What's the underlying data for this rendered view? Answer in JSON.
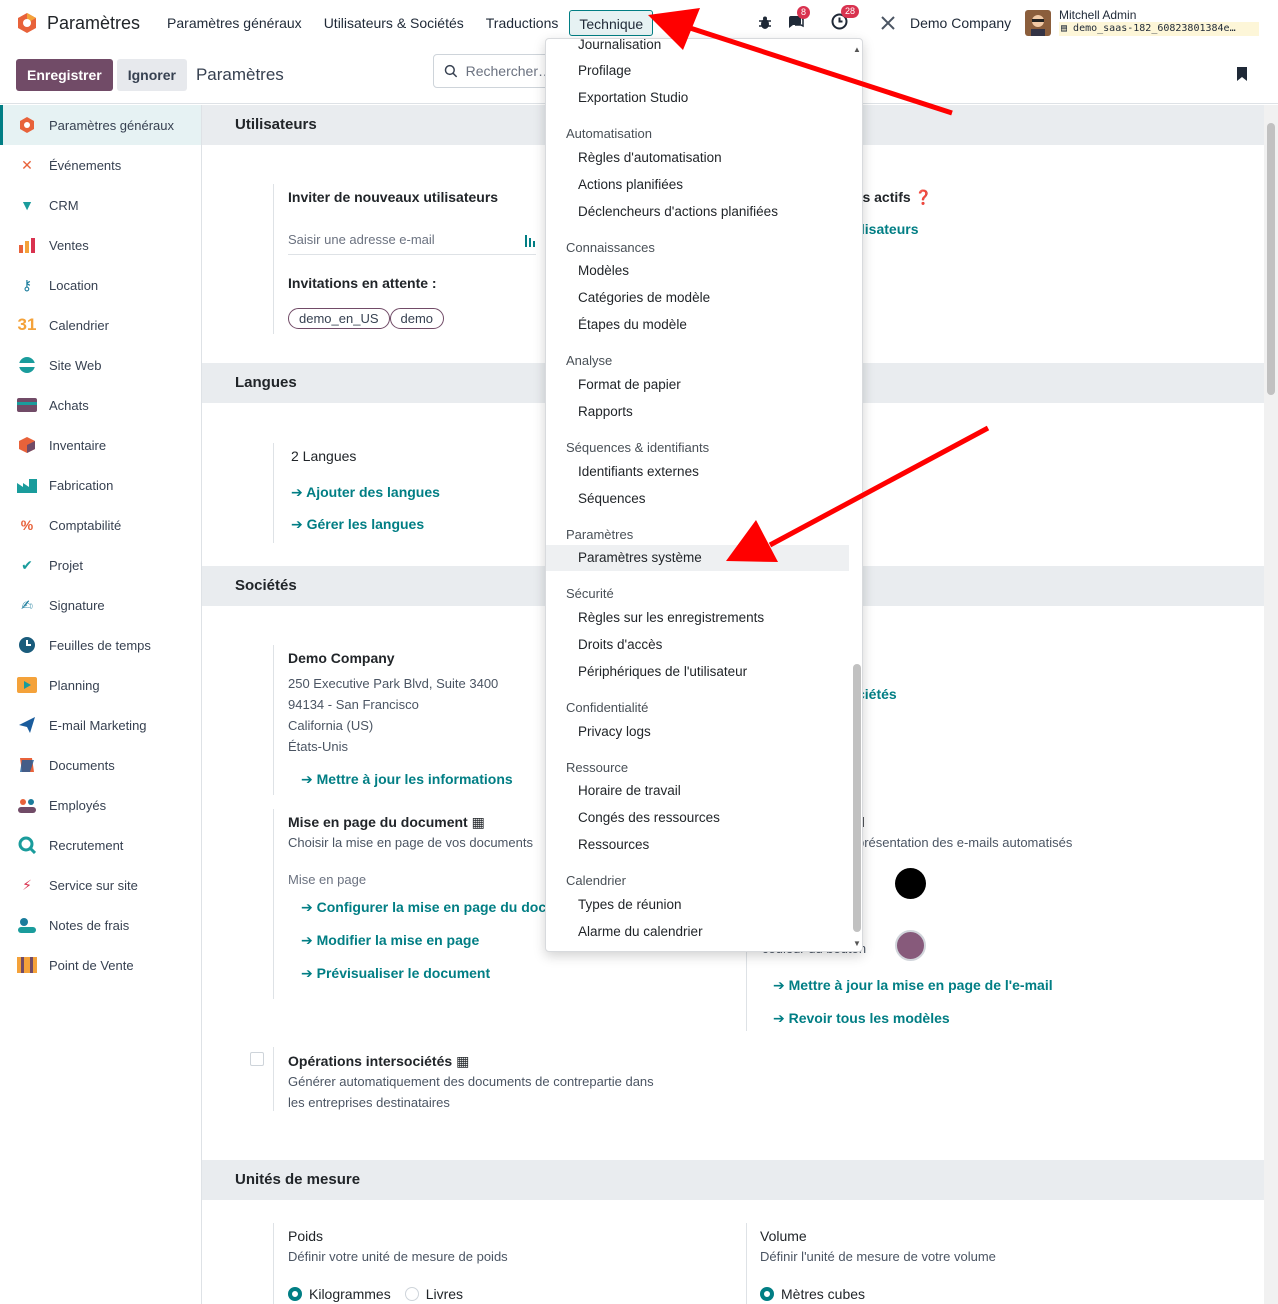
{
  "topbar": {
    "app_title": "Paramètres",
    "menu": [
      "Paramètres généraux",
      "Utilisateurs & Sociétés",
      "Traductions",
      "Technique"
    ],
    "messages_badge": "8",
    "activity_badge": "28",
    "company": "Demo Company",
    "user_name": "Mitchell Admin",
    "db_name": "demo_saas-182_60823801384e…"
  },
  "control": {
    "save_label": "Enregistrer",
    "discard_label": "Ignorer",
    "breadcrumb": "Paramètres",
    "search_placeholder": "Rechercher…"
  },
  "sidebar": {
    "items": [
      "Paramètres généraux",
      "Événements",
      "CRM",
      "Ventes",
      "Location",
      "Calendrier",
      "Site Web",
      "Achats",
      "Inventaire",
      "Fabrication",
      "Comptabilité",
      "Projet",
      "Signature",
      "Feuilles de temps",
      "Planning",
      "E-mail Marketing",
      "Documents",
      "Employés",
      "Recrutement",
      "Service sur site",
      "Notes de frais",
      "Point de Vente"
    ]
  },
  "users": {
    "header": "Utilisateurs",
    "invite_title": "Inviter de nouveaux utilisateurs",
    "email_placeholder": "Saisir une adresse e-mail",
    "pending_label": "Invitations en attente :",
    "pending": [
      "demo_en_US",
      "demo"
    ],
    "active_users_label": "rs actifs",
    "manage_users": "ilisateurs"
  },
  "languages": {
    "header": "Langues",
    "count": "2 Langues",
    "add": "Ajouter des langues",
    "manage": "Gérer les langues"
  },
  "companies": {
    "header": "Sociétés",
    "name": "Demo Company",
    "address": [
      "250 Executive Park Blvd, Suite 3400",
      "94134 - San Francisco",
      "California (US)",
      "États-Unis"
    ],
    "update": "Mettre à jour les informations",
    "manage_fragment": "ciétés",
    "layout_title": "Mise en page du document",
    "layout_desc": "Choisir la mise en page de vos documents",
    "layout_label": "Mise en page",
    "configure": "Configurer la mise en page du docu",
    "edit_layout": "Modifier la mise en page",
    "preview": "Prévisualiser le document",
    "email_title_fragment": "il",
    "email_desc_fragment": "présentation des e-mails automatisés",
    "button_color_label_fragment": "couleur du bouton",
    "email_update": "Mettre à jour la mise en page de l'e-mail",
    "review_templates": "Revoir tous les modèles",
    "inter_title": "Opérations intersociétés",
    "inter_desc": [
      "Générer automatiquement des documents de contrepartie dans",
      "les entreprises destinataires"
    ],
    "colors": {
      "primary": "#000000",
      "button": "#875a7b"
    }
  },
  "uom": {
    "header": "Unités de mesure",
    "weight_title": "Poids",
    "weight_desc": "Définir votre unité de mesure de poids",
    "kg": "Kilogrammes",
    "lb": "Livres",
    "volume_title": "Volume",
    "volume_desc": "Définir l'unité de mesure de votre volume",
    "m3": "Mètres cubes"
  },
  "technical_menu": {
    "items_top": [
      "Journalisation",
      "Profilage",
      "Exportation Studio"
    ],
    "groups": [
      {
        "title": "Automatisation",
        "items": [
          "Règles d'automatisation",
          "Actions planifiées",
          "Déclencheurs d'actions planifiées"
        ]
      },
      {
        "title": "Connaissances",
        "items": [
          "Modèles",
          "Catégories de modèle",
          "Étapes du modèle"
        ]
      },
      {
        "title": "Analyse",
        "items": [
          "Format de papier",
          "Rapports"
        ]
      },
      {
        "title": "Séquences & identifiants",
        "items": [
          "Identifiants externes",
          "Séquences"
        ]
      },
      {
        "title": "Paramètres",
        "items": [
          "Paramètres système"
        ]
      },
      {
        "title": "Sécurité",
        "items": [
          "Règles sur les enregistrements",
          "Droits d'accès",
          "Périphériques de l'utilisateur"
        ]
      },
      {
        "title": "Confidentialité",
        "items": [
          "Privacy logs"
        ]
      },
      {
        "title": "Ressource",
        "items": [
          "Horaire de travail",
          "Congés des ressources",
          "Ressources"
        ]
      },
      {
        "title": "Calendrier",
        "items": [
          "Types de réunion",
          "Alarme du calendrier"
        ]
      }
    ],
    "highlighted": "Paramètres système"
  },
  "annotation_color": "#ff0000"
}
